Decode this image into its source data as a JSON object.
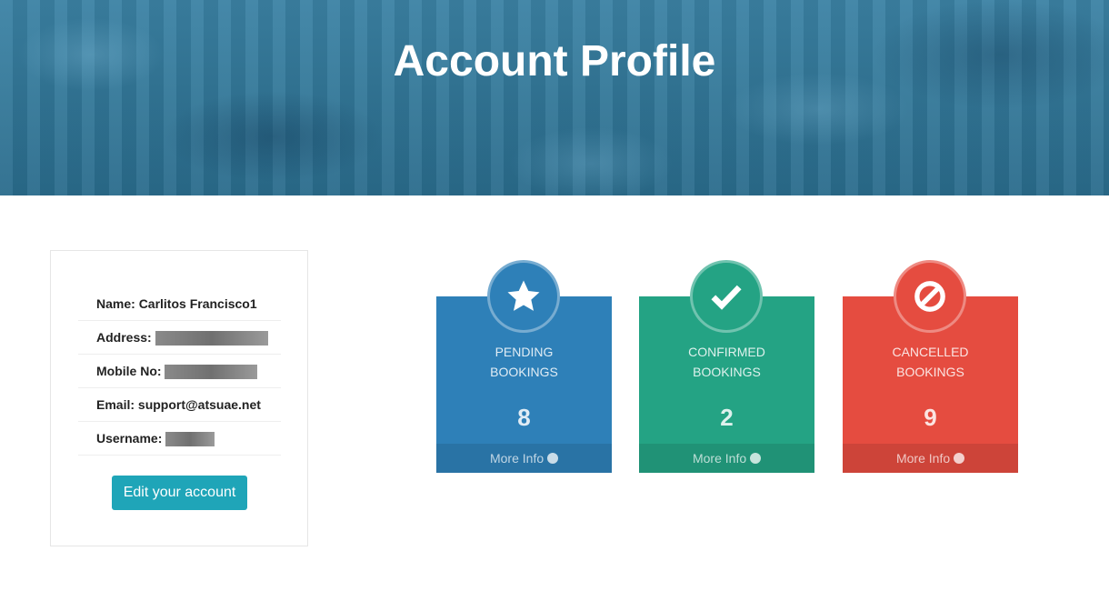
{
  "header": {
    "title": "Account Profile"
  },
  "profile": {
    "name_label": "Name:",
    "name_value": "Carlitos Francisco1",
    "address_label": "Address:",
    "mobile_label": "Mobile No:",
    "email_label": "Email:",
    "email_value": "support@atsuae.net",
    "username_label": "Username:",
    "edit_button": "Edit your account"
  },
  "cards": [
    {
      "line1": "PENDING",
      "line2": "BOOKINGS",
      "count": "8",
      "more": "More Info",
      "icon": "star-icon",
      "color": "#2e80b8"
    },
    {
      "line1": "CONFIRMED",
      "line2": "BOOKINGS",
      "count": "2",
      "more": "More Info",
      "icon": "check-icon",
      "color": "#24a384"
    },
    {
      "line1": "CANCELLED",
      "line2": "BOOKINGS",
      "count": "9",
      "more": "More Info",
      "icon": "ban-icon",
      "color": "#e54c40"
    }
  ]
}
